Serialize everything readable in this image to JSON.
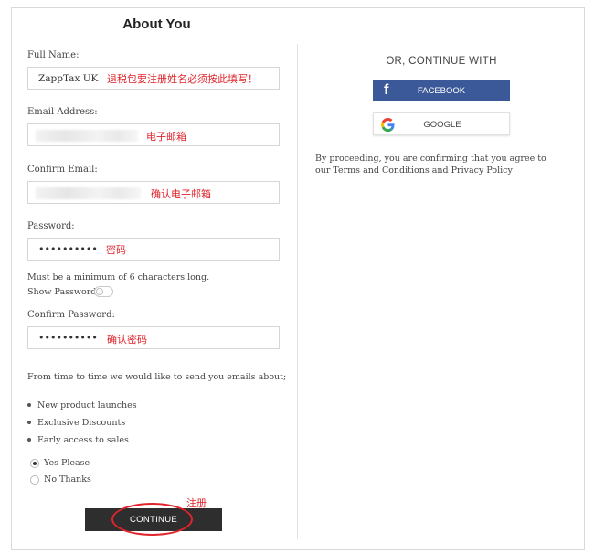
{
  "form": {
    "title": "About You",
    "full_name": {
      "label": "Full Name:",
      "value": "ZappTax UK",
      "note": "退税包要注册姓名必须按此填写！"
    },
    "email": {
      "label": "Email Address:",
      "note": "电子邮箱"
    },
    "confirm_email": {
      "label": "Confirm Email:",
      "note": "确认电子邮箱"
    },
    "password": {
      "label": "Password:",
      "value": "••••••••••",
      "note": "密码"
    },
    "password_hint": "Must be a minimum of 6 characters long.",
    "show_password_label": "Show Password",
    "confirm_password": {
      "label": "Confirm Password:",
      "value": "••••••••••",
      "note": "确认密码"
    },
    "emails_intro": "From time to time we would like to send you emails about;",
    "email_topics": [
      "New product launches",
      "Exclusive Discounts",
      "Early access to sales"
    ],
    "radio_options": [
      {
        "label": "Yes Please",
        "selected": true
      },
      {
        "label": "No Thanks",
        "selected": false
      }
    ],
    "register_note": "注册",
    "continue_label": "CONTINUE"
  },
  "social": {
    "title": "OR, CONTINUE WITH",
    "facebook_label": "FACEBOOK",
    "facebook_icon": "f",
    "google_label": "GOOGLE",
    "consent_text": "By proceeding, you are confirming that you agree to our Terms and Conditions and Privacy Policy",
    "facebook_color": "#3b5998"
  },
  "colors": {
    "annotation_red": "#e0242b",
    "button_dark": "#2e2e2e"
  }
}
